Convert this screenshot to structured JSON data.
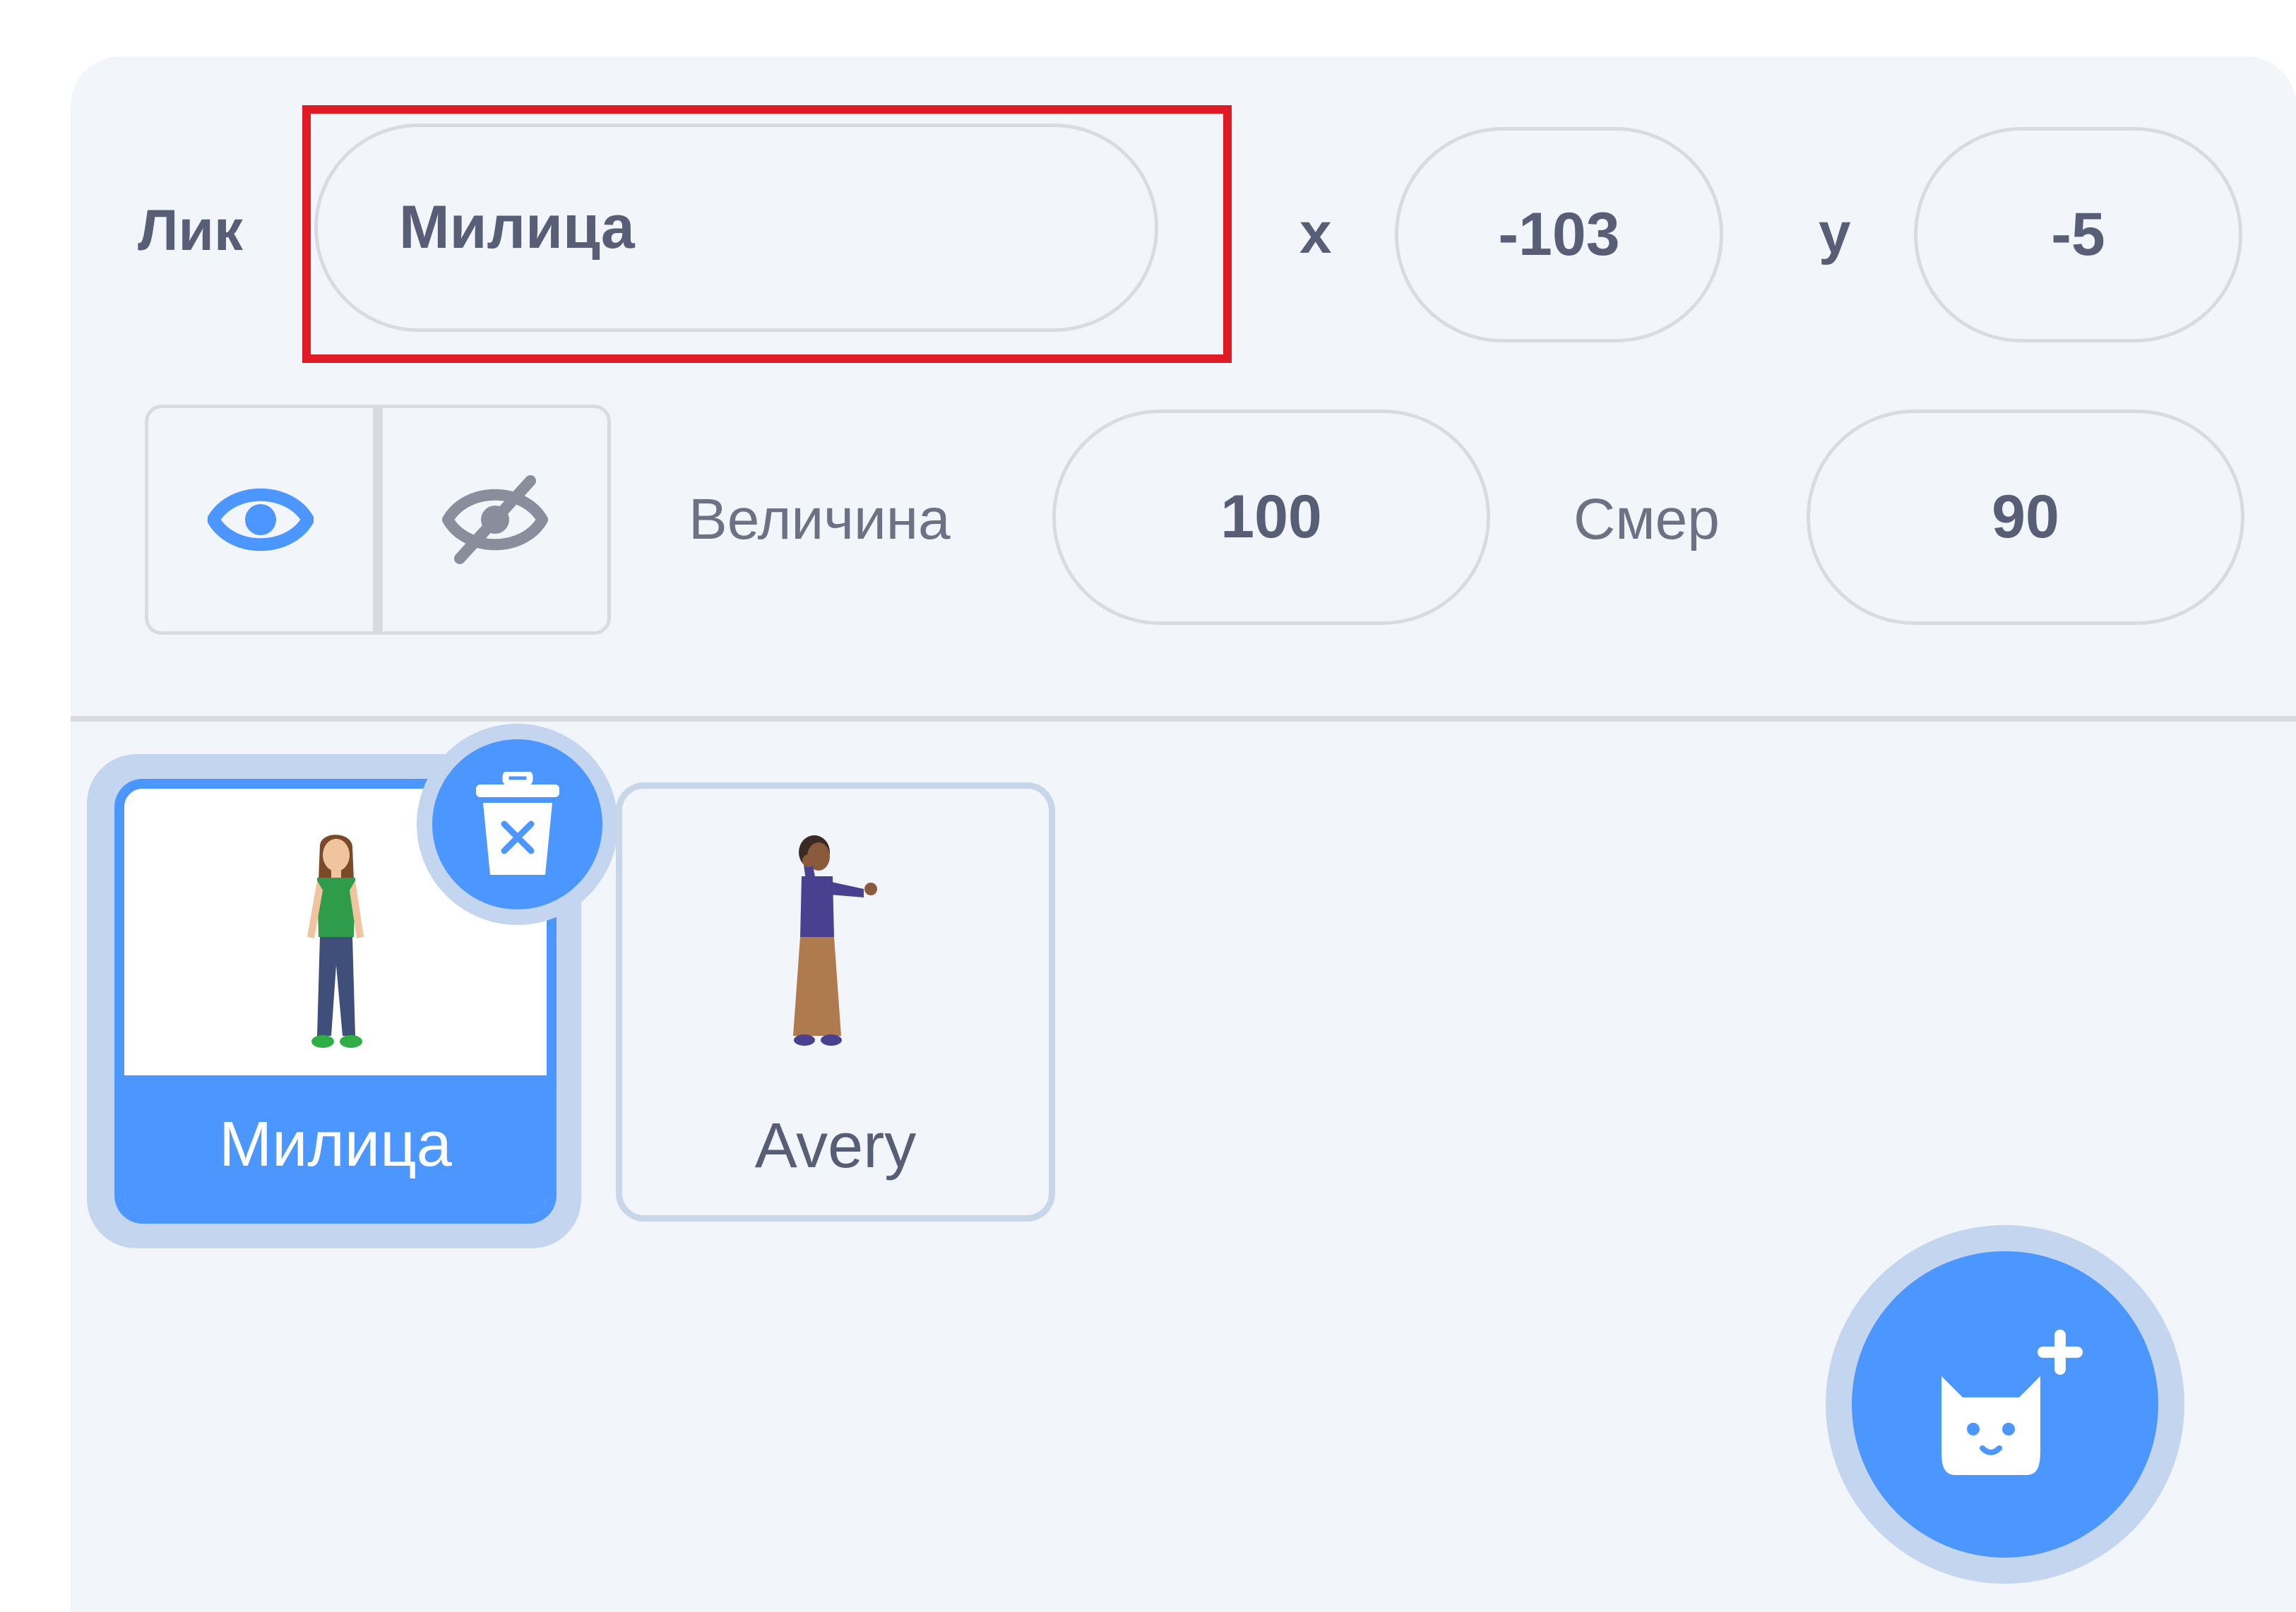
{
  "sprite_info": {
    "name_label": "Лик",
    "name_value": "Милица",
    "x_label": "x",
    "x_value": "-103",
    "y_label": "y",
    "y_value": "-5",
    "show_icon": "eye-icon",
    "hide_icon": "eye-slash-icon",
    "size_label": "Величина",
    "size_value": "100",
    "direction_label": "Смер",
    "direction_value": "90"
  },
  "sprites": [
    {
      "name": "Милица",
      "selected": true,
      "icon": "girl-sprite-thumbnail"
    },
    {
      "name": "Avery",
      "selected": false,
      "icon": "avery-sprite-thumbnail"
    }
  ],
  "actions": {
    "delete_icon": "trash-icon",
    "add_sprite_icon": "cat-plus-icon"
  },
  "colors": {
    "accent": "#4c97ff",
    "highlight": "#e01b24",
    "panel_bg": "#f2f6fb",
    "text": "#575e75"
  }
}
